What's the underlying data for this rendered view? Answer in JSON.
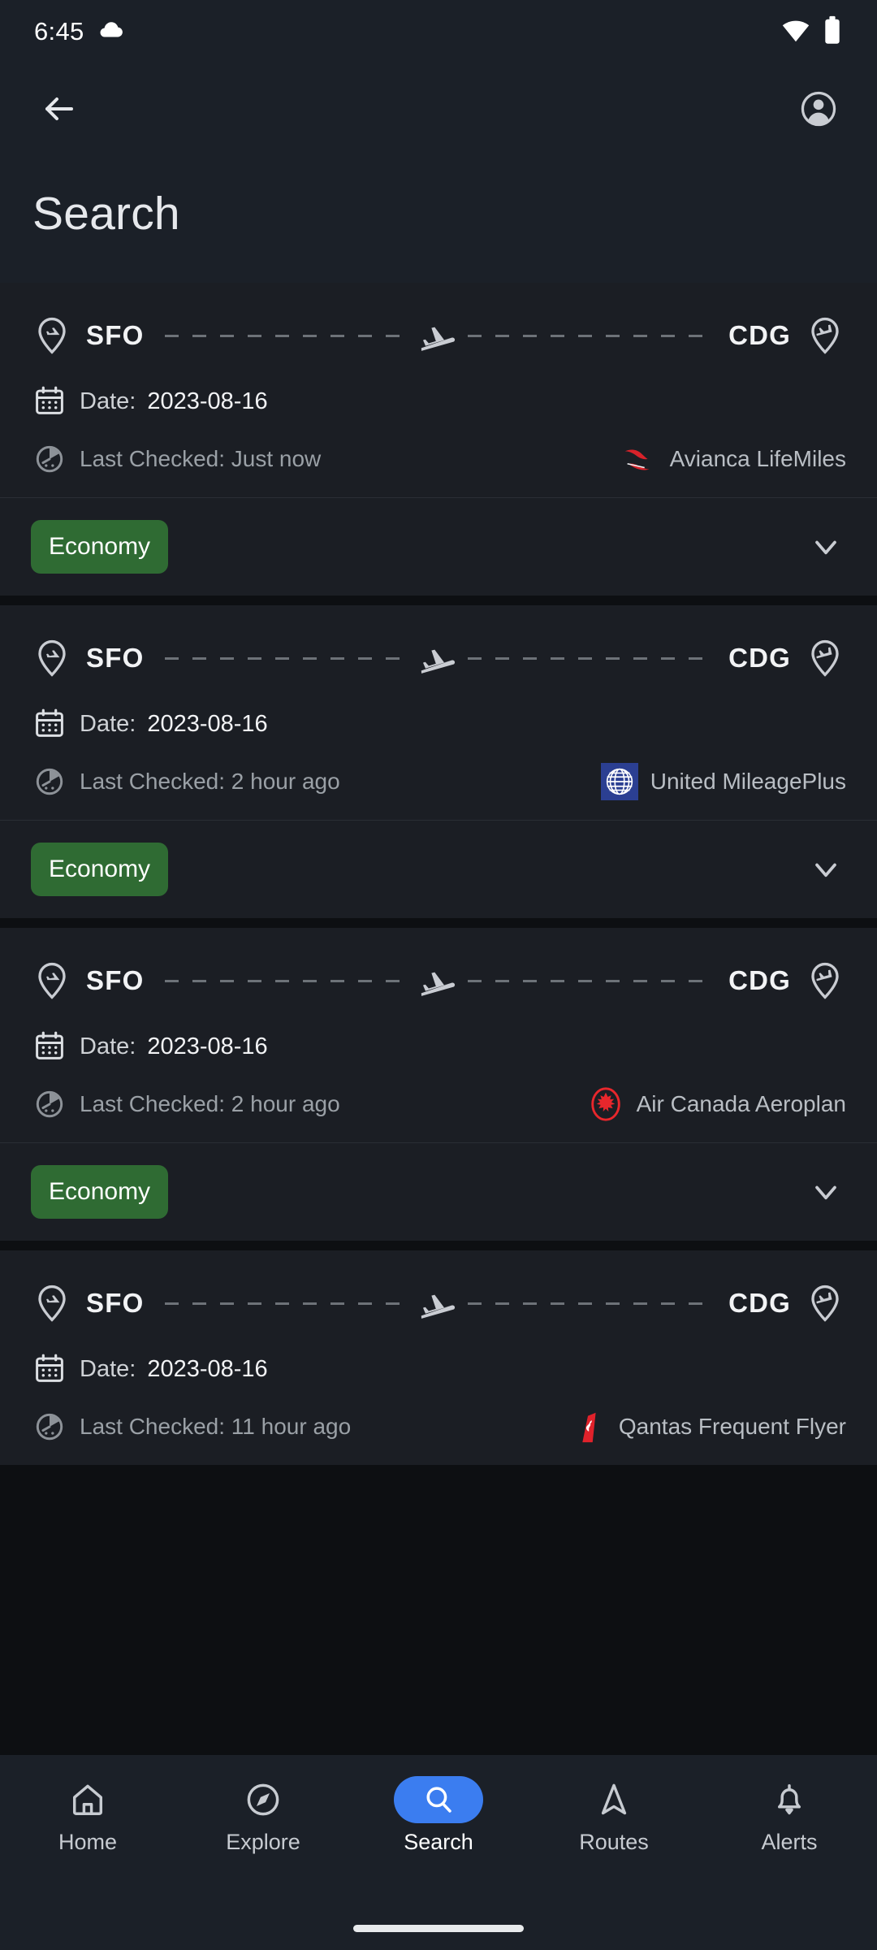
{
  "status_bar": {
    "time": "6:45",
    "weather_icon": "cloud-icon",
    "wifi_icon": "wifi-icon",
    "battery_icon": "battery-icon"
  },
  "app_bar": {
    "back_icon": "arrow-left-icon",
    "account_icon": "account-circle-icon",
    "title": "Search"
  },
  "list": {
    "date_label": "Date:",
    "checked_prefix": "Last Checked:",
    "cards": [
      {
        "origin": "SFO",
        "destination": "CDG",
        "date": "2023-08-16",
        "last_checked": "Last Checked: Just now",
        "airline": "Avianca LifeMiles",
        "airline_logo": "avianca-logo",
        "cabin": "Economy",
        "expand_icon": "chevron-down-icon"
      },
      {
        "origin": "SFO",
        "destination": "CDG",
        "date": "2023-08-16",
        "last_checked": "Last Checked: 2 hour ago",
        "airline": "United MileagePlus",
        "airline_logo": "united-logo",
        "cabin": "Economy",
        "expand_icon": "chevron-down-icon"
      },
      {
        "origin": "SFO",
        "destination": "CDG",
        "date": "2023-08-16",
        "last_checked": "Last Checked: 2 hour ago",
        "airline": "Air Canada Aeroplan",
        "airline_logo": "air-canada-logo",
        "cabin": "Economy",
        "expand_icon": "chevron-down-icon"
      },
      {
        "origin": "SFO",
        "destination": "CDG",
        "date": "2023-08-16",
        "last_checked": "Last Checked: 11 hour ago",
        "airline": "Qantas Frequent Flyer",
        "airline_logo": "qantas-logo",
        "cabin": "",
        "expand_icon": ""
      }
    ]
  },
  "bottom_nav": {
    "items": [
      {
        "label": "Home",
        "icon": "home-icon",
        "active": false
      },
      {
        "label": "Explore",
        "icon": "compass-icon",
        "active": false
      },
      {
        "label": "Search",
        "icon": "search-icon",
        "active": true
      },
      {
        "label": "Routes",
        "icon": "navigation-icon",
        "active": false
      },
      {
        "label": "Alerts",
        "icon": "bell-icon",
        "active": false
      }
    ]
  },
  "colors": {
    "accent": "#3b7df0",
    "cabin_badge": "#2f6b33",
    "app_bar_bg": "#1b2028",
    "card_bg": "#1b1e24",
    "list_bg": "#0d0f12"
  }
}
